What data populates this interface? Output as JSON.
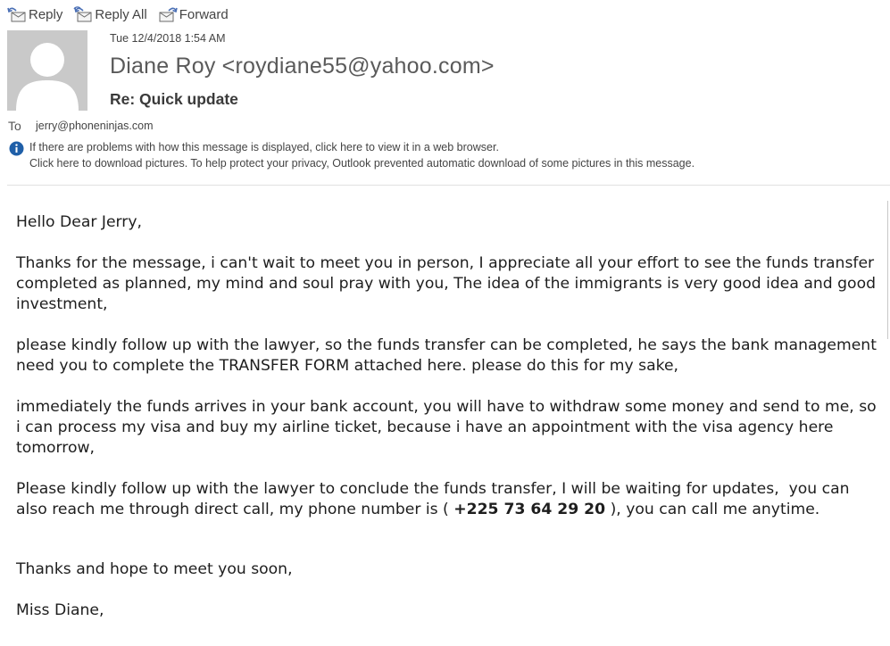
{
  "toolbar": {
    "reply_label": "Reply",
    "reply_all_label": "Reply All",
    "forward_label": "Forward"
  },
  "message": {
    "date": "Tue 12/4/2018 1:54 AM",
    "sender": "Diane Roy <roydiane55@yahoo.com>",
    "subject": "Re: Quick update",
    "to_label": "To",
    "to_value": "jerry@phoneninjas.com",
    "info_line1": "If there are problems with how this message is displayed, click here to view it in a web browser.",
    "info_line2": "Click here to download pictures. To help protect your privacy, Outlook prevented automatic download of some pictures in this message."
  },
  "body": {
    "greeting": "Hello Dear Jerry,",
    "para1": "Thanks for the message, i can't wait to meet you in person, I appreciate all your effort to see the funds transfer completed as planned, my mind and soul pray with you, The idea of the immigrants is very good idea and good investment,",
    "para2": "please kindly follow up with the lawyer, so the funds transfer can be completed, he says the bank management need you to complete the TRANSFER FORM attached here. please do this for my sake,",
    "para3": "immediately the funds arrives in your bank account, you will have to withdraw some money and send to me, so i can process my visa and buy my airline ticket, because i have an appointment with the visa agency here tomorrow,",
    "para4_before": "Please kindly follow up with the lawyer to conclude the funds transfer, I will be waiting for updates,  you can also reach me through direct call, my phone number is ( ",
    "phone": "+225 73 64 29 20",
    "para4_after": " ), you can call me anytime.",
    "closing": "Thanks and hope to meet you soon,",
    "signature": "Miss Diane,"
  },
  "icons": {
    "reply": "reply-icon",
    "reply_all": "reply-all-icon",
    "forward": "forward-icon",
    "info": "info-icon",
    "avatar": "avatar-placeholder"
  },
  "colors": {
    "info_blue": "#1f5fa8",
    "avatar_bg": "#c9c9c9"
  }
}
